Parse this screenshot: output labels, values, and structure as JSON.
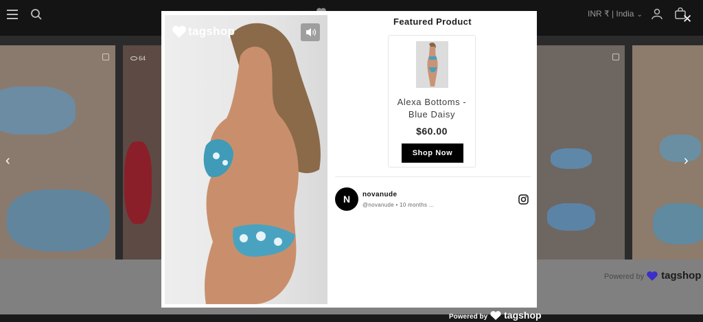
{
  "header": {
    "currency_label": "INR ₹ | India"
  },
  "gallery": {
    "view_count": "64"
  },
  "powered_by": {
    "label": "Powered by",
    "brand": "tagshop"
  },
  "modal": {
    "photo_logo": "tagshop",
    "featured_title": "Featured Product",
    "product": {
      "name": "Alexa Bottoms - Blue Daisy",
      "price": "$60.00",
      "button_label": "Shop Now"
    },
    "author": {
      "initial": "N",
      "name": "novanude",
      "handle_time": "@novanude • 10 months ..."
    }
  },
  "colors": {
    "overlay": "#2b2b2b",
    "button": "#000000",
    "brand_purple": "#3b2fc9"
  }
}
